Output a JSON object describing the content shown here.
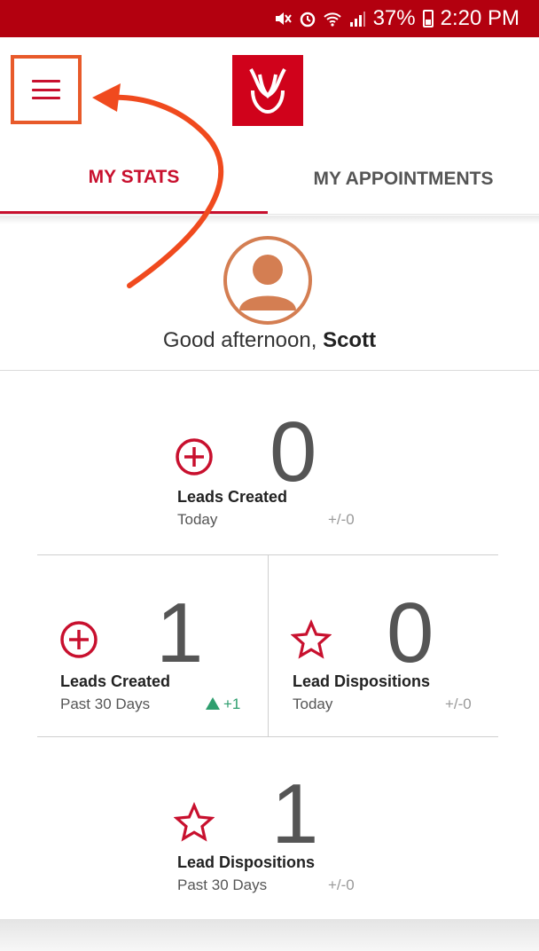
{
  "statusbar": {
    "battery": "37%",
    "time": "2:20 PM"
  },
  "tabs": [
    {
      "label": "MY STATS"
    },
    {
      "label": "MY APPOINTMENTS"
    }
  ],
  "greeting": {
    "prefix": "Good afternoon, ",
    "name": "Scott"
  },
  "stats": [
    {
      "icon": "plus-circle-icon",
      "value": "0",
      "title": "Leads Created",
      "period": "Today",
      "delta": "+/-0"
    },
    {
      "icon": "plus-circle-icon",
      "value": "1",
      "title": "Leads Created",
      "period": "Past 30 Days",
      "delta": "+1"
    },
    {
      "icon": "star-icon",
      "value": "0",
      "title": "Lead Dispositions",
      "period": "Today",
      "delta": "+/-0"
    },
    {
      "icon": "star-icon",
      "value": "1",
      "title": "Lead Dispositions",
      "period": "Past 30 Days",
      "delta": "+/-0"
    }
  ],
  "colors": {
    "brand": "#c8102e",
    "statusbar": "#b3000f",
    "avatar": "#d47e52",
    "delta_up": "#2e9e6e",
    "highlight": "#e85a2a"
  }
}
